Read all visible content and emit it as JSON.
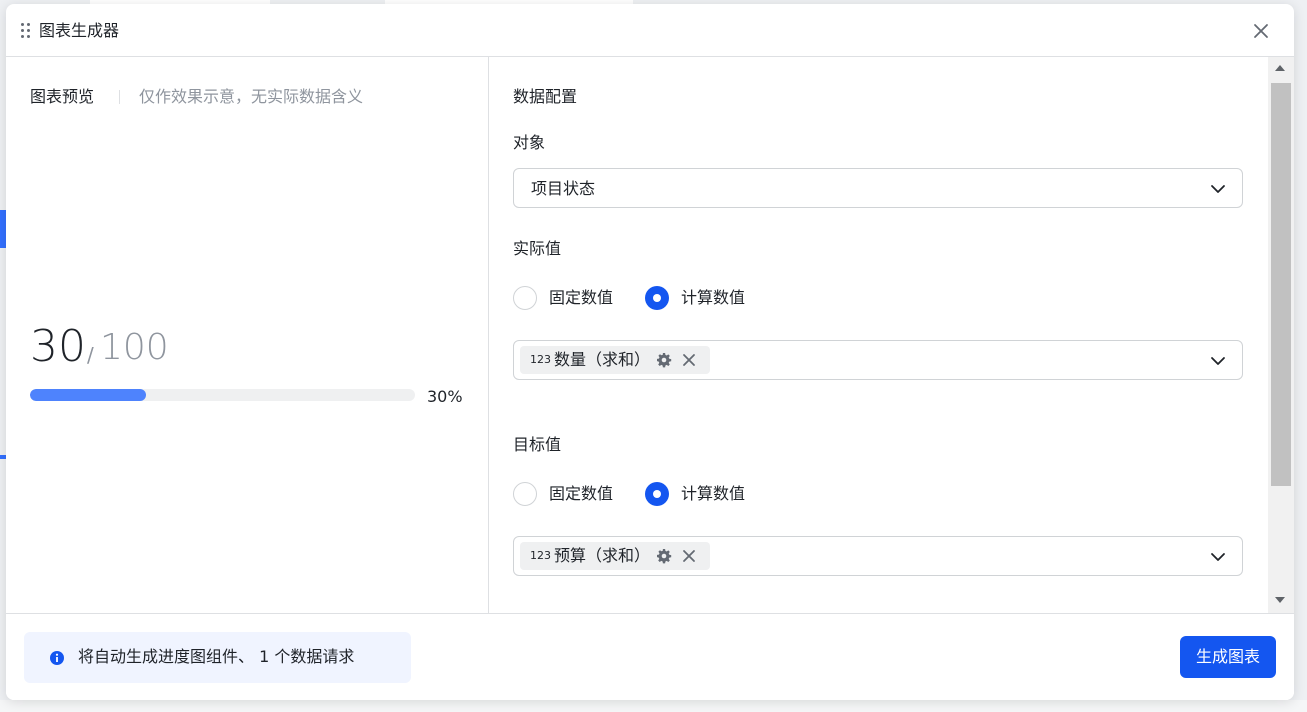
{
  "modal": {
    "title": "图表生成器"
  },
  "preview": {
    "title": "图表预览",
    "note": "仅作效果示意，无实际数据含义",
    "value": "30",
    "separator": "/",
    "target": "100",
    "percent_label": "30%",
    "progress_fraction": 0.3
  },
  "config": {
    "section_title": "数据配置",
    "object": {
      "label": "对象",
      "selected": "项目状态"
    },
    "actual": {
      "label": "实际值",
      "option_fixed": "固定数值",
      "option_computed": "计算数值",
      "selected_option": "计算数值",
      "field_type": "123",
      "field_tag": "数量（求和）"
    },
    "target": {
      "label": "目标值",
      "option_fixed": "固定数值",
      "option_computed": "计算数值",
      "selected_option": "计算数值",
      "field_type": "123",
      "field_tag": "预算（求和）"
    }
  },
  "footer": {
    "info_text": "将自动生成进度图组件、 1 个数据请求",
    "generate_button": "生成图表"
  },
  "colors": {
    "accent": "#1456f0",
    "progress_fill": "#4e83fd",
    "info_bg": "#f0f4ff"
  }
}
